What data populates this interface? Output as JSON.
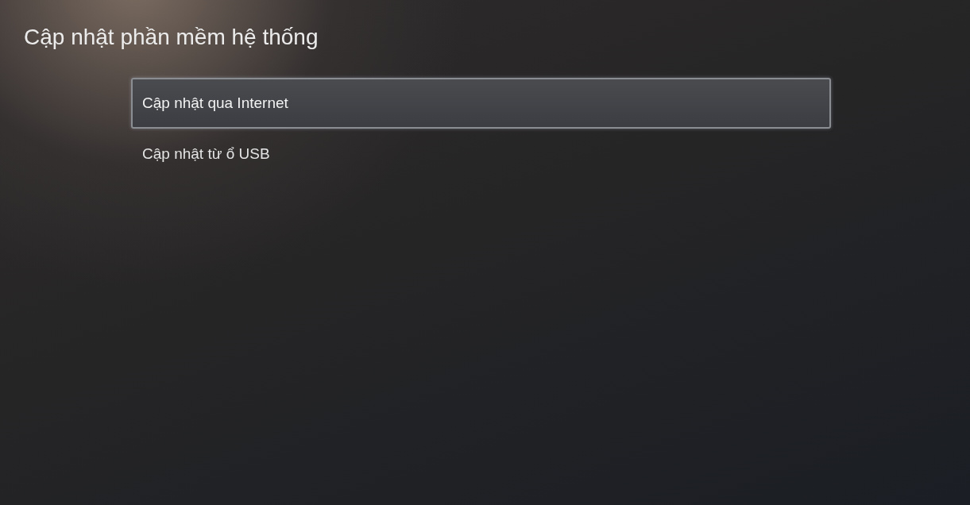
{
  "title": "Cập nhật phần mềm hệ thống",
  "menu": [
    {
      "label": "Cập nhật qua Internet",
      "selected": true
    },
    {
      "label": "Cập nhật từ ổ USB",
      "selected": false
    }
  ]
}
